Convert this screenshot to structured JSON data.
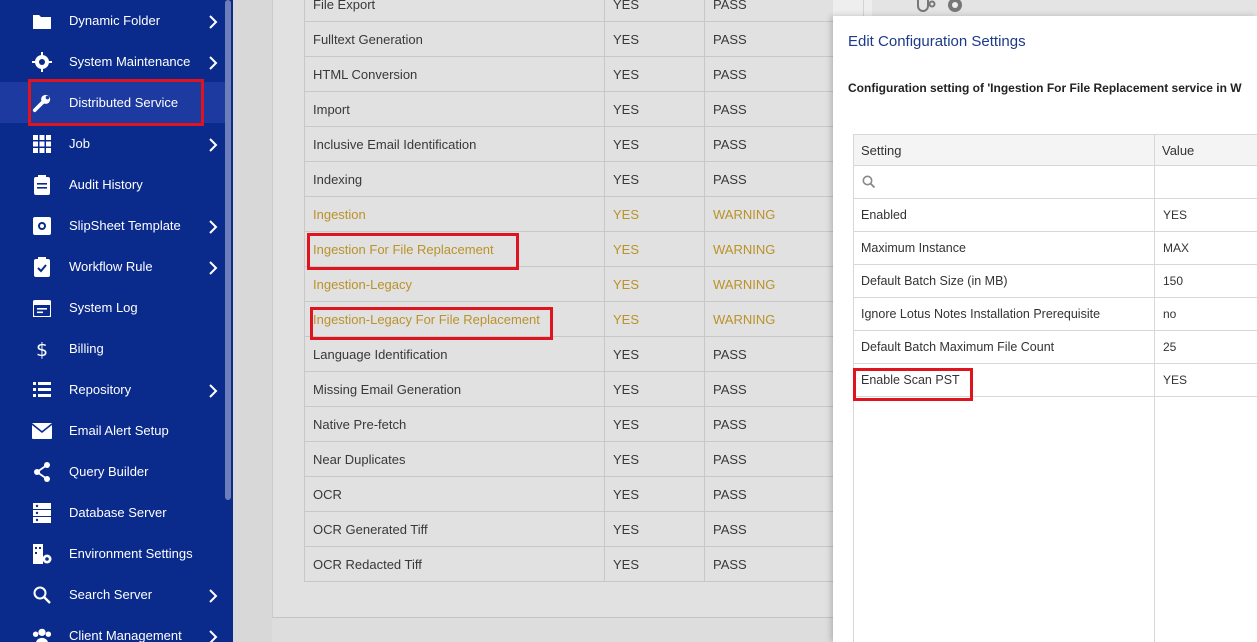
{
  "sidebar": {
    "items": [
      {
        "label": "Dynamic Folder",
        "icon": "folder-icon",
        "has_submenu": true
      },
      {
        "label": "System Maintenance",
        "icon": "gear-icon",
        "has_submenu": true
      },
      {
        "label": "Distributed Service",
        "icon": "wrench-icon",
        "has_submenu": false,
        "active": true
      },
      {
        "label": "Job",
        "icon": "grid-icon",
        "has_submenu": true
      },
      {
        "label": "Audit History",
        "icon": "clipboard-icon",
        "has_submenu": false
      },
      {
        "label": "SlipSheet Template",
        "icon": "template-icon",
        "has_submenu": true
      },
      {
        "label": "Workflow Rule",
        "icon": "clipboard-check-icon",
        "has_submenu": true
      },
      {
        "label": "System Log",
        "icon": "calendar-icon",
        "has_submenu": false
      },
      {
        "label": "Billing",
        "icon": "dollar-icon",
        "has_submenu": false
      },
      {
        "label": "Repository",
        "icon": "list-icon",
        "has_submenu": true
      },
      {
        "label": "Email Alert Setup",
        "icon": "envelope-icon",
        "has_submenu": false
      },
      {
        "label": "Query Builder",
        "icon": "share-icon",
        "has_submenu": false
      },
      {
        "label": "Database Server",
        "icon": "server-icon",
        "has_submenu": false
      },
      {
        "label": "Environment Settings",
        "icon": "building-gear-icon",
        "has_submenu": false
      },
      {
        "label": "Search Server",
        "icon": "search-icon",
        "has_submenu": true
      },
      {
        "label": "Client Management",
        "icon": "users-icon",
        "has_submenu": true
      }
    ]
  },
  "services_table": {
    "rows": [
      {
        "name": "File Export",
        "enabled": "YES",
        "status": "PASS"
      },
      {
        "name": "Fulltext Generation",
        "enabled": "YES",
        "status": "PASS"
      },
      {
        "name": "HTML Conversion",
        "enabled": "YES",
        "status": "PASS"
      },
      {
        "name": "Import",
        "enabled": "YES",
        "status": "PASS"
      },
      {
        "name": "Inclusive Email Identification",
        "enabled": "YES",
        "status": "PASS"
      },
      {
        "name": "Indexing",
        "enabled": "YES",
        "status": "PASS"
      },
      {
        "name": "Ingestion",
        "enabled": "YES",
        "status": "WARNING"
      },
      {
        "name": "Ingestion For File Replacement",
        "enabled": "YES",
        "status": "WARNING"
      },
      {
        "name": "Ingestion-Legacy",
        "enabled": "YES",
        "status": "WARNING"
      },
      {
        "name": "Ingestion-Legacy For File Replacement",
        "enabled": "YES",
        "status": "WARNING"
      },
      {
        "name": "Language Identification",
        "enabled": "YES",
        "status": "PASS"
      },
      {
        "name": "Missing Email Generation",
        "enabled": "YES",
        "status": "PASS"
      },
      {
        "name": "Native Pre-fetch",
        "enabled": "YES",
        "status": "PASS"
      },
      {
        "name": "Near Duplicates",
        "enabled": "YES",
        "status": "PASS"
      },
      {
        "name": "OCR",
        "enabled": "YES",
        "status": "PASS"
      },
      {
        "name": "OCR Generated Tiff",
        "enabled": "YES",
        "status": "PASS"
      },
      {
        "name": "OCR Redacted Tiff",
        "enabled": "YES",
        "status": "PASS"
      }
    ]
  },
  "modal": {
    "title": "Edit Configuration Settings",
    "subtitle": "Configuration setting of 'Ingestion For File Replacement service in W",
    "columns": {
      "setting": "Setting",
      "value": "Value"
    },
    "settings": [
      {
        "setting": "Enabled",
        "value": "YES"
      },
      {
        "setting": "Maximum Instance",
        "value": "MAX"
      },
      {
        "setting": "Default Batch Size (in MB)",
        "value": "150"
      },
      {
        "setting": "Ignore Lotus Notes Installation Prerequisite",
        "value": "no"
      },
      {
        "setting": "Default Batch Maximum File Count",
        "value": "25"
      },
      {
        "setting": "Enable Scan PST",
        "value": "YES"
      }
    ]
  },
  "colors": {
    "sidebar_bg": "#0a2a8c",
    "warning_text": "#c49a2c",
    "highlight": "#e0141e",
    "modal_title": "#1d3a8a"
  }
}
